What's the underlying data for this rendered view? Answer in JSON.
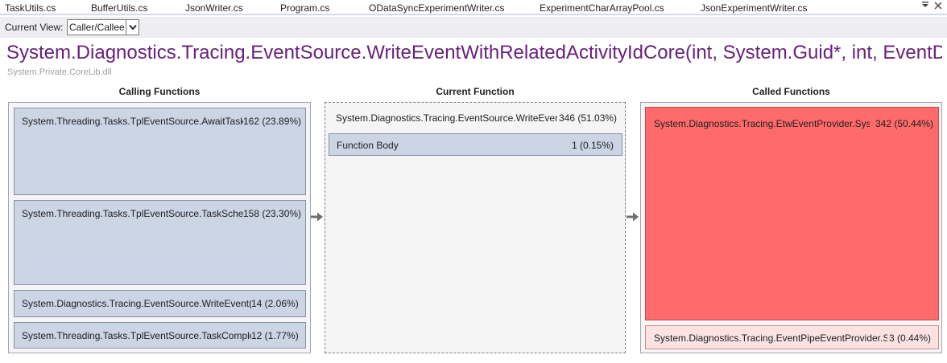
{
  "tabs": [
    {
      "label": "TaskUtils.cs"
    },
    {
      "label": "BufferUtils.cs"
    },
    {
      "label": "JsonWriter.cs"
    },
    {
      "label": "Program.cs"
    },
    {
      "label": "ODataSyncExperimentWriter.cs"
    },
    {
      "label": "ExperimentCharArrayPool.cs"
    },
    {
      "label": "JsonExperimentWriter.cs"
    }
  ],
  "tab_menu_icon": "dropdown-menu-icon",
  "tab_close_icon": "close-icon",
  "toolbar": {
    "view_label": "Current View:",
    "view_value": "Caller/Callee"
  },
  "function": {
    "title": "System.Diagnostics.Tracing.EventSource.WriteEventWithRelatedActivityIdCore(int, System.Guid*, int, EventD…",
    "module": "System.Private.CoreLib.dll"
  },
  "calling": {
    "header": "Calling Functions",
    "items": [
      {
        "name": "System.Threading.Tasks.TplEventSource.AwaitTask…",
        "value": "162 (23.89%)"
      },
      {
        "name": "System.Threading.Tasks.TplEventSource.TaskSche…",
        "value": "158 (23.30%)"
      },
      {
        "name": "System.Diagnostics.Tracing.EventSource.WriteEvent(i…",
        "value": "14 (2.06%)"
      },
      {
        "name": "System.Threading.Tasks.TplEventSource.TaskComple…",
        "value": "12 (1.77%)"
      }
    ]
  },
  "current": {
    "header": "Current Function",
    "name": "System.Diagnostics.Tracing.EventSource.WriteEven…",
    "value": "346 (51.03%)",
    "body_label": "Function Body",
    "body_value": "1 (0.15%)"
  },
  "called": {
    "header": "Called Functions",
    "items": [
      {
        "name": "System.Diagnostics.Tracing.EtwEventProvider.Syst…",
        "value": "342 (50.44%)"
      },
      {
        "name": "System.Diagnostics.Tracing.EventPipeEventProvider.S…",
        "value": "3 (0.44%)"
      }
    ]
  },
  "colors": {
    "title": "#68217a",
    "box_default": "#ccd5e4",
    "box_hot": "#ff6b6b",
    "box_warm": "#fde2e2"
  }
}
